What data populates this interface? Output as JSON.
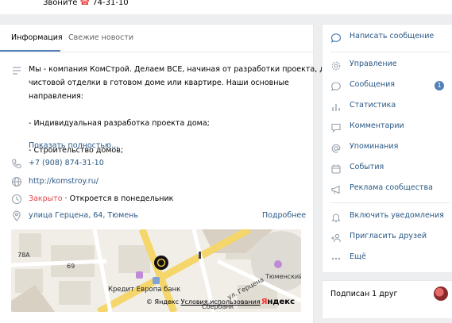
{
  "header": {
    "phone_prefix": "Звоните ",
    "phone_icon": "☎",
    "phone_number": " 74-31-10"
  },
  "tabs": [
    {
      "label": "Информация",
      "active": true
    },
    {
      "label": "Свежие новости",
      "active": false
    }
  ],
  "info": {
    "description_lines": [
      "Мы - компания КомСтрой. Делаем ВСЕ, начиная от разработки проекта, до",
      "чистовой отделки в готовом доме или квартире. Наши основные",
      "направления:",
      "",
      "- Индивидуальная разработка проекта дома;",
      "",
      "- Строительство домов;"
    ],
    "show_more": "Показать полностью…",
    "phone": "+7 (908) 874-31-10",
    "website": "http://komstroy.ru/",
    "status_closed": "Закрыто",
    "status_opens": " · Откроется в понедельник",
    "address": "улица Герцена, 64, Тюмень",
    "address_more": "Подробнее"
  },
  "map": {
    "labels": [
      "78А",
      "69",
      "Кредит Европа банк",
      "Тюменский цирк",
      "ул. Герцена",
      "Сбербанк"
    ],
    "copyright": "© Яндекс",
    "terms": "Условия использования",
    "brand_first": "Я",
    "brand_rest": "ндекс"
  },
  "sidebar": {
    "items": [
      {
        "icon": "message-icon",
        "label": "Написать сообщение"
      },
      {
        "icon": "gear-icon",
        "label": "Управление"
      },
      {
        "icon": "chat-bubble-icon",
        "label": "Сообщения",
        "badge": "1"
      },
      {
        "icon": "bar-chart-icon",
        "label": "Статистика"
      },
      {
        "icon": "comment-icon",
        "label": "Комментарии"
      },
      {
        "icon": "at-icon",
        "label": "Упоминания"
      },
      {
        "icon": "calendar-icon",
        "label": "События"
      },
      {
        "icon": "megaphone-icon",
        "label": "Реклама сообщества"
      },
      {
        "icon": "bell-icon",
        "label": "Включить уведомления"
      },
      {
        "icon": "add-person-icon",
        "label": "Пригласить друзей"
      },
      {
        "icon": "more-dots-icon",
        "label": "Ещё"
      }
    ]
  },
  "friends": {
    "label": "Подписан 1 друг"
  },
  "colors": {
    "accent": "#5181b8",
    "link": "#2a5885",
    "closed": "#e64646",
    "background": "#edeef0"
  }
}
